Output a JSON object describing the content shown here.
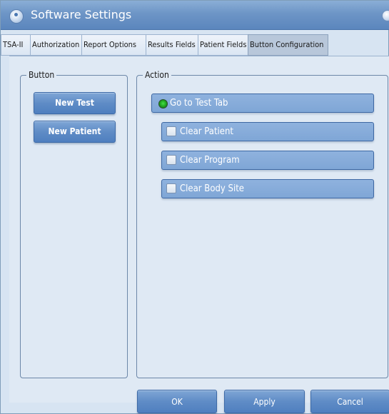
{
  "window": {
    "title": "Software Settings"
  },
  "tabs": [
    {
      "label": "TSA-II",
      "active": false
    },
    {
      "label": "Authorization",
      "active": false
    },
    {
      "label": "Report Options",
      "active": false
    },
    {
      "label": "Results Fields",
      "active": false
    },
    {
      "label": "Patient Fields",
      "active": false
    },
    {
      "label": "Button Configuration",
      "active": true
    }
  ],
  "button_group": {
    "title": "Button",
    "buttons": [
      "New Test",
      "New Patient"
    ]
  },
  "action_group": {
    "title": "Action",
    "options": [
      {
        "label": "Go to Test Tab",
        "type": "radio",
        "selected": true
      },
      {
        "label": "Clear Patient",
        "type": "checkbox",
        "checked": false
      },
      {
        "label": "Clear Program",
        "type": "checkbox",
        "checked": false
      },
      {
        "label": "Clear Body Site",
        "type": "checkbox",
        "checked": false
      }
    ]
  },
  "footer": {
    "ok_label": "OK",
    "apply_label": "Apply",
    "cancel_label": "Cancel"
  },
  "colors": {
    "title_bar": "#6d95c6",
    "button": "#5f8cc6",
    "selected_radio": "#1e9f1e"
  },
  "icons": {
    "app": "settings-app-icon",
    "close": "close-icon"
  }
}
